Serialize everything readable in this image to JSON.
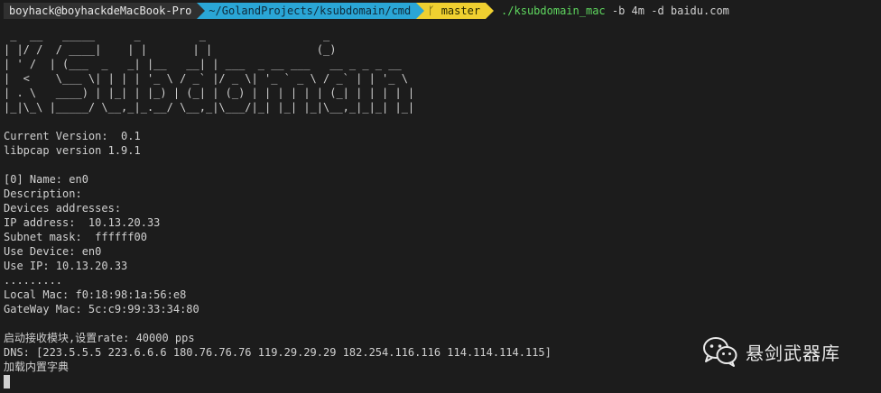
{
  "prompt": {
    "user": "boyhack@boyhackdeMacBook-Pro",
    "path": "~/GolandProjects/ksubdomain/cmd",
    "git_branch": "ᚴ master",
    "command_bin": "./ksubdomain_mac",
    "command_args": " -b 4m -d baidu.com"
  },
  "banner": [
    " _  __   _____      _         _                  _",
    "| |/ /  / ____|    | |       | |                (_)",
    "| ' /  | (___  _   _| |__   __| | ___  _ __ ___   __ _ _ _ __",
    "|  <    \\___ \\| | | | '_ \\ / _` |/ _ \\| '_ ` _ \\ / _` | | '_ \\",
    "| . \\   ____) | |_| | |_) | (_| | (_) | | | | | | (_| | | | | |",
    "|_|\\_\\ |_____/ \\__,_|_.__/ \\__,_|\\___/|_| |_| |_|\\__,_|_|_| |_|"
  ],
  "info": {
    "version": "Current Version:  0.1",
    "libpcap": "libpcap version 1.9.1"
  },
  "device": {
    "name": "[0] Name: en0",
    "description": "Description:",
    "addresses": "Devices addresses:",
    "ip": "IP address:  10.13.20.33",
    "subnet": "Subnet mask:  ffffff00",
    "use_device": "Use Device: en0",
    "use_ip": "Use IP: 10.13.20.33",
    "dots": ".........",
    "local_mac": "Local Mac: f0:18:98:1a:56:e8",
    "gateway_mac": "GateWay Mac: 5c:c9:99:33:34:80"
  },
  "status": {
    "receiver": "启动接收模块,设置rate: 40000 pps",
    "dns": "DNS: [223.5.5.5 223.6.6.6 180.76.76.76 119.29.29.29 182.254.116.116 114.114.114.115]",
    "dict": "加载内置字典"
  },
  "watermark": {
    "text": "悬剑武器库",
    "icon": "wechat-icon"
  }
}
